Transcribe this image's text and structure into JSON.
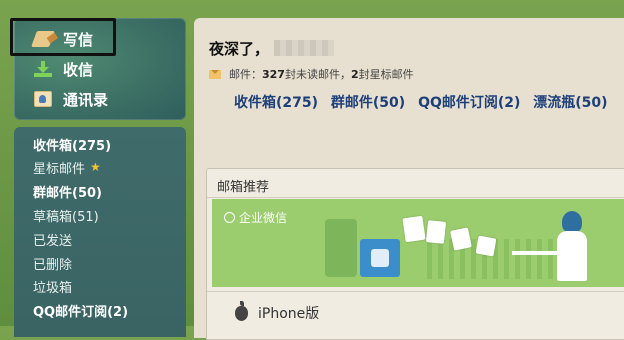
{
  "sidebar": {
    "top": {
      "write": {
        "label": "写信",
        "icon": "pencil-icon"
      },
      "inbox": {
        "label": "收信",
        "icon": "download-icon"
      },
      "contacts": {
        "label": "通讯录",
        "icon": "contact-card-icon"
      }
    },
    "folders": [
      {
        "label": "收件箱(275)",
        "bold": true
      },
      {
        "label": "星标邮件",
        "bold": false,
        "icon": "star-icon"
      },
      {
        "label": "群邮件(50)",
        "bold": true
      },
      {
        "label": "草稿箱(51)",
        "bold": false
      },
      {
        "label": "已发送",
        "bold": false
      },
      {
        "label": "已删除",
        "bold": false
      },
      {
        "label": "垃圾箱",
        "bold": false
      },
      {
        "label": "QQ邮件订阅(2)",
        "bold": true
      }
    ]
  },
  "main": {
    "greeting": "夜深了，",
    "mail_info": {
      "prefix": "邮件：",
      "unread_count": "327",
      "unread_text": " 封未读邮件，",
      "star_count": "2",
      "star_text": " 封星标邮件"
    },
    "quick_links": [
      "收件箱(275)",
      "群邮件(50)",
      "QQ邮件订阅(2)",
      "漂流瓶(50)"
    ],
    "recommend": {
      "title": "邮箱推荐",
      "banner_label": "企业微信",
      "iphone_label": "iPhone版"
    }
  },
  "colors": {
    "accent_link": "#1d3f7a",
    "sidebar_bg": "#3f6b6a",
    "banner_green": "#9bcc6e",
    "star": "#f2c230"
  }
}
